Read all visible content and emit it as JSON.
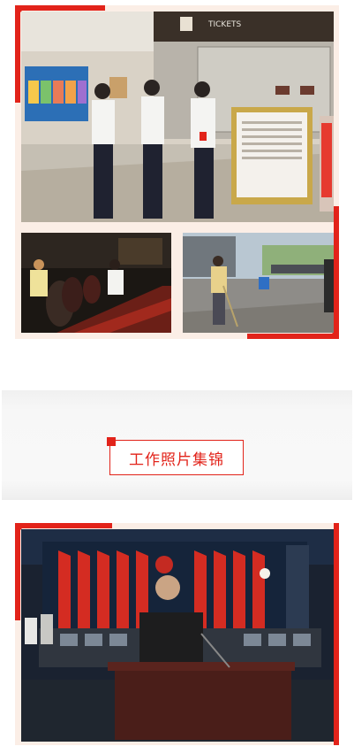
{
  "section_title": "工作照片集锦",
  "photos": [
    {
      "name": "lobby-staff-photo",
      "signage": "TICKETS"
    },
    {
      "name": "conference-cleaning-photo"
    },
    {
      "name": "outdoor-cleaning-photo"
    },
    {
      "name": "auditorium-speech-photo"
    }
  ],
  "colors": {
    "accent": "#e2231a",
    "frame": "#fbeee6"
  }
}
